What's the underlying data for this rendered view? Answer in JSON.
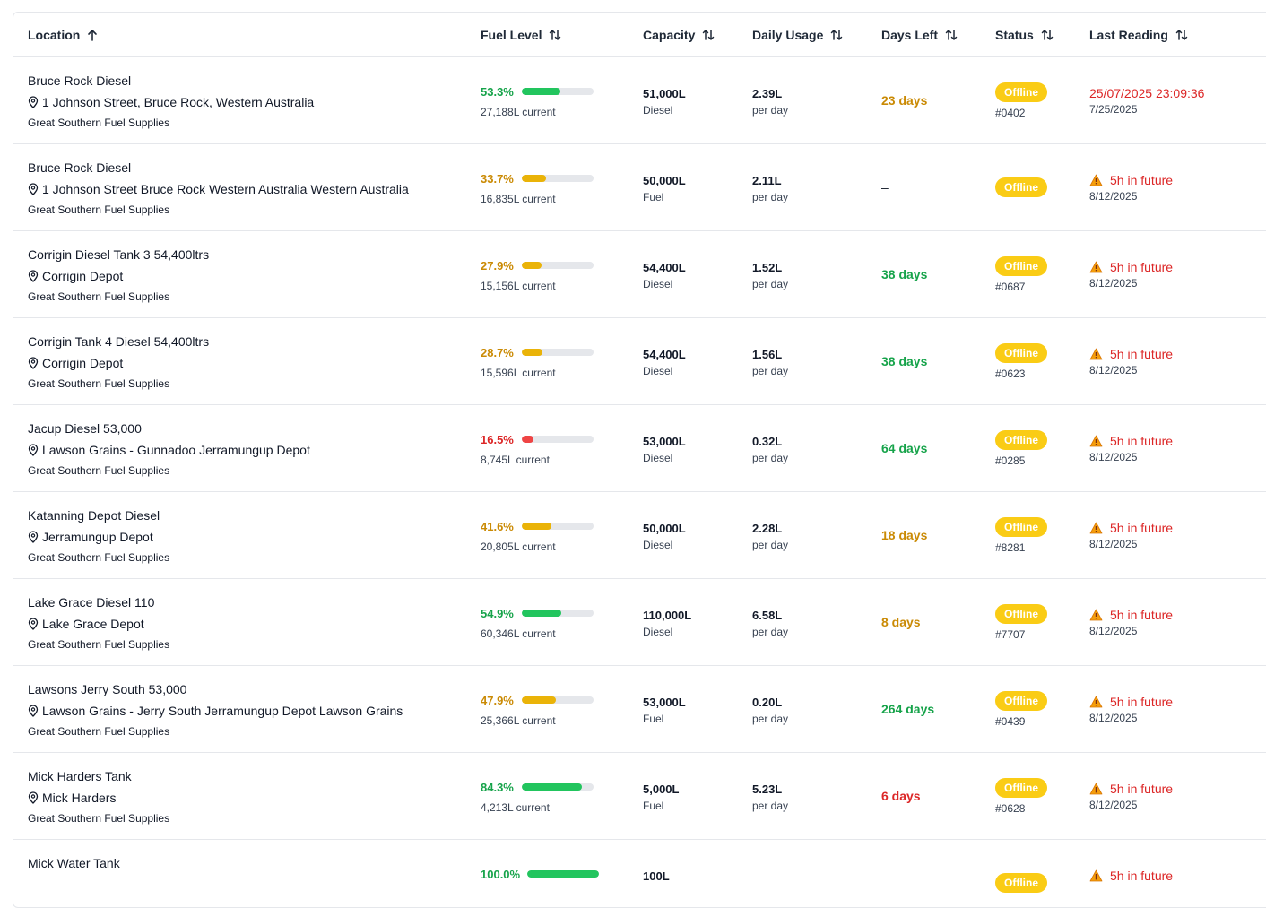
{
  "headers": {
    "location": "Location",
    "fuel_level": "Fuel Level",
    "capacity": "Capacity",
    "daily_usage": "Daily Usage",
    "days_left": "Days Left",
    "status": "Status",
    "last_reading": "Last Reading"
  },
  "colors": {
    "green": "#16a34a",
    "green_bar": "#22c55e",
    "amber": "#ca8a04",
    "amber_bar": "#eab308",
    "red": "#dc2626",
    "red_bar": "#ef4444",
    "badge": "#facc15"
  },
  "rows": [
    {
      "name": "Bruce Rock Diesel",
      "address": "1 Johnson Street, Bruce Rock, Western Australia",
      "supplier": "Great Southern Fuel Supplies",
      "fuel_pct": "53.3%",
      "fuel_fraction": 0.533,
      "fuel_color": "green",
      "current": "27,188L current",
      "capacity": "51,000L",
      "fuel_type": "Diesel",
      "usage": "2.39L",
      "usage_unit": "per day",
      "days_left": "23 days",
      "days_color": "amber",
      "status": "Offline",
      "device": "#0402",
      "last_main": "25/07/2025 23:09:36",
      "last_warn": false,
      "last_sub": "7/25/2025"
    },
    {
      "name": "Bruce Rock Diesel",
      "address": "1 Johnson Street Bruce Rock Western Australia Western Australia",
      "supplier": "Great Southern Fuel Supplies",
      "fuel_pct": "33.7%",
      "fuel_fraction": 0.337,
      "fuel_color": "amber",
      "current": "16,835L current",
      "capacity": "50,000L",
      "fuel_type": "Fuel",
      "usage": "2.11L",
      "usage_unit": "per day",
      "days_left": "–",
      "days_color": "dark",
      "status": "Offline",
      "device": "",
      "last_main": "5h in future",
      "last_warn": true,
      "last_sub": "8/12/2025"
    },
    {
      "name": "Corrigin Diesel Tank 3 54,400ltrs",
      "address": "Corrigin Depot",
      "supplier": "Great Southern Fuel Supplies",
      "fuel_pct": "27.9%",
      "fuel_fraction": 0.279,
      "fuel_color": "amber",
      "current": "15,156L current",
      "capacity": "54,400L",
      "fuel_type": "Diesel",
      "usage": "1.52L",
      "usage_unit": "per day",
      "days_left": "38 days",
      "days_color": "green",
      "status": "Offline",
      "device": "#0687",
      "last_main": "5h in future",
      "last_warn": true,
      "last_sub": "8/12/2025"
    },
    {
      "name": "Corrigin Tank 4 Diesel 54,400ltrs",
      "address": "Corrigin Depot",
      "supplier": "Great Southern Fuel Supplies",
      "fuel_pct": "28.7%",
      "fuel_fraction": 0.287,
      "fuel_color": "amber",
      "current": "15,596L current",
      "capacity": "54,400L",
      "fuel_type": "Diesel",
      "usage": "1.56L",
      "usage_unit": "per day",
      "days_left": "38 days",
      "days_color": "green",
      "status": "Offline",
      "device": "#0623",
      "last_main": "5h in future",
      "last_warn": true,
      "last_sub": "8/12/2025"
    },
    {
      "name": "Jacup Diesel 53,000",
      "address": "Lawson Grains - Gunnadoo Jerramungup Depot",
      "supplier": "Great Southern Fuel Supplies",
      "fuel_pct": "16.5%",
      "fuel_fraction": 0.165,
      "fuel_color": "red",
      "current": "8,745L current",
      "capacity": "53,000L",
      "fuel_type": "Diesel",
      "usage": "0.32L",
      "usage_unit": "per day",
      "days_left": "64 days",
      "days_color": "green",
      "status": "Offline",
      "device": "#0285",
      "last_main": "5h in future",
      "last_warn": true,
      "last_sub": "8/12/2025"
    },
    {
      "name": "Katanning Depot Diesel",
      "address": "Jerramungup Depot",
      "supplier": "Great Southern Fuel Supplies",
      "fuel_pct": "41.6%",
      "fuel_fraction": 0.416,
      "fuel_color": "amber",
      "current": "20,805L current",
      "capacity": "50,000L",
      "fuel_type": "Diesel",
      "usage": "2.28L",
      "usage_unit": "per day",
      "days_left": "18 days",
      "days_color": "amber",
      "status": "Offline",
      "device": "#8281",
      "last_main": "5h in future",
      "last_warn": true,
      "last_sub": "8/12/2025"
    },
    {
      "name": "Lake Grace Diesel 110",
      "address": "Lake Grace Depot",
      "supplier": "Great Southern Fuel Supplies",
      "fuel_pct": "54.9%",
      "fuel_fraction": 0.549,
      "fuel_color": "green",
      "current": "60,346L current",
      "capacity": "110,000L",
      "fuel_type": "Diesel",
      "usage": "6.58L",
      "usage_unit": "per day",
      "days_left": "8 days",
      "days_color": "amber",
      "status": "Offline",
      "device": "#7707",
      "last_main": "5h in future",
      "last_warn": true,
      "last_sub": "8/12/2025"
    },
    {
      "name": "Lawsons Jerry South 53,000",
      "address": "Lawson Grains - Jerry South Jerramungup Depot Lawson Grains",
      "supplier": "Great Southern Fuel Supplies",
      "fuel_pct": "47.9%",
      "fuel_fraction": 0.479,
      "fuel_color": "amber",
      "current": "25,366L current",
      "capacity": "53,000L",
      "fuel_type": "Fuel",
      "usage": "0.20L",
      "usage_unit": "per day",
      "days_left": "264 days",
      "days_color": "green",
      "status": "Offline",
      "device": "#0439",
      "last_main": "5h in future",
      "last_warn": true,
      "last_sub": "8/12/2025"
    },
    {
      "name": "Mick Harders Tank",
      "address": "Mick Harders",
      "supplier": "Great Southern Fuel Supplies",
      "fuel_pct": "84.3%",
      "fuel_fraction": 0.843,
      "fuel_color": "green",
      "current": "4,213L current",
      "capacity": "5,000L",
      "fuel_type": "Fuel",
      "usage": "5.23L",
      "usage_unit": "per day",
      "days_left": "6 days",
      "days_color": "red",
      "status": "Offline",
      "device": "#0628",
      "last_main": "5h in future",
      "last_warn": true,
      "last_sub": "8/12/2025"
    },
    {
      "name": "Mick Water Tank",
      "address": "",
      "supplier": "",
      "fuel_pct": "100.0%",
      "fuel_fraction": 1.0,
      "fuel_color": "green",
      "current": "",
      "capacity": "100L",
      "fuel_type": "",
      "usage": "",
      "usage_unit": "",
      "days_left": "",
      "days_color": "dark",
      "status": "Offline",
      "device": "",
      "last_main": "5h in future",
      "last_warn": true,
      "last_sub": ""
    }
  ]
}
